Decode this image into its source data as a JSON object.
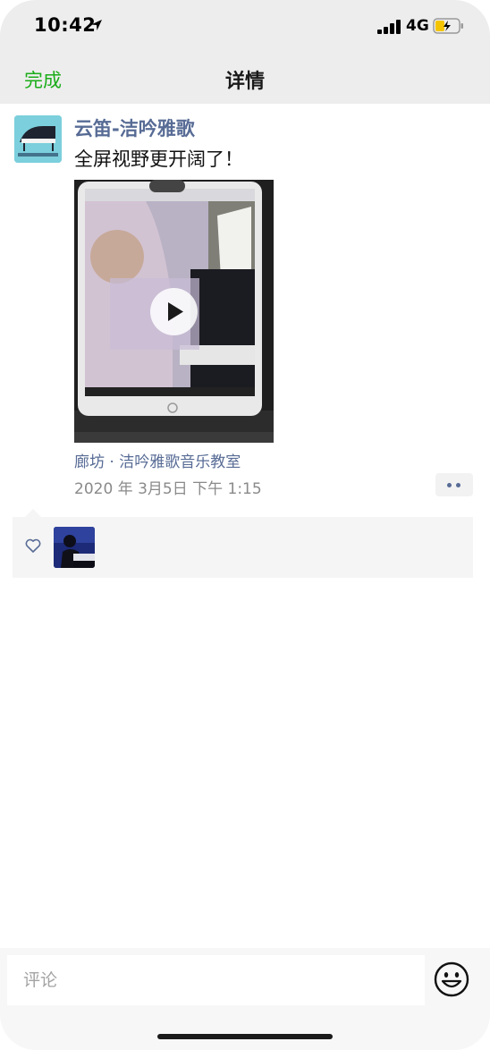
{
  "status_bar": {
    "time": "10:42",
    "network": "4G"
  },
  "nav": {
    "done_label": "完成",
    "title": "详情"
  },
  "post": {
    "author": "云笛-洁吟雅歌",
    "text": "全屏视野更开阔了！",
    "location": "廊坊 · 洁吟雅歌音乐教室",
    "timestamp": "2020 年 3月5日 下午 1:15"
  },
  "comment": {
    "placeholder": "评论"
  },
  "colors": {
    "accent_green": "#1aad19",
    "link_blue": "#576b95",
    "nav_bg": "#ededed"
  },
  "icons": [
    "location-arrow-icon",
    "signal-icon",
    "battery-charging-icon",
    "play-icon",
    "more-dots-icon",
    "heart-icon",
    "emoji-icon"
  ]
}
